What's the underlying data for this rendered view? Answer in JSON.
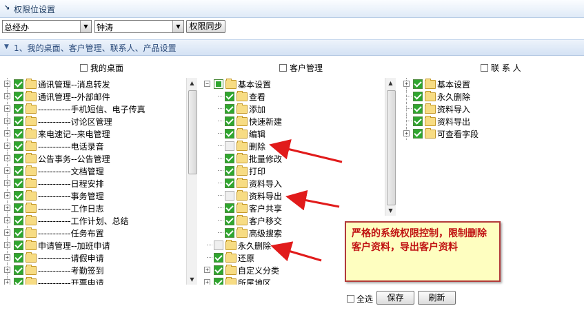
{
  "titlebar": {
    "title": "权限位设置"
  },
  "filters": {
    "department": "总经办",
    "user": "钟涛",
    "sync_button": "权限同步"
  },
  "section": {
    "title": "1、我的桌面、客户管理、联系人、产品设置"
  },
  "columns": {
    "desktop": {
      "header": "我的桌面",
      "items": [
        {
          "label": "通讯管理--消息转发",
          "state": "checked",
          "expand": "plus"
        },
        {
          "label": "通讯管理--外部邮件",
          "state": "checked",
          "expand": "plus"
        },
        {
          "label": "-----------手机短信、电子传真",
          "state": "checked",
          "expand": "plus"
        },
        {
          "label": "-----------讨论区管理",
          "state": "checked",
          "expand": "plus"
        },
        {
          "label": "来电速记--来电管理",
          "state": "checked",
          "expand": "plus"
        },
        {
          "label": "-----------电话录音",
          "state": "checked",
          "expand": "plus"
        },
        {
          "label": "公告事务--公告管理",
          "state": "checked",
          "expand": "plus"
        },
        {
          "label": "-----------文档管理",
          "state": "checked",
          "expand": "plus"
        },
        {
          "label": "-----------日程安排",
          "state": "checked",
          "expand": "plus"
        },
        {
          "label": "-----------事务管理",
          "state": "checked",
          "expand": "plus"
        },
        {
          "label": "-----------工作日志",
          "state": "checked",
          "expand": "plus"
        },
        {
          "label": "-----------工作计划、总结",
          "state": "checked",
          "expand": "plus"
        },
        {
          "label": "-----------任务布置",
          "state": "checked",
          "expand": "plus"
        },
        {
          "label": "申请管理--加班申请",
          "state": "checked",
          "expand": "plus"
        },
        {
          "label": "-----------请假申请",
          "state": "checked",
          "expand": "plus"
        },
        {
          "label": "-----------考勤签到",
          "state": "checked",
          "expand": "plus"
        },
        {
          "label": "-----------开票申请",
          "state": "checked",
          "expand": "plus"
        }
      ]
    },
    "customer": {
      "header": "客户管理",
      "items": [
        {
          "label": "基本设置",
          "state": "partial",
          "expand": "minus",
          "level": 0
        },
        {
          "label": "查看",
          "state": "checked",
          "level": 1
        },
        {
          "label": "添加",
          "state": "checked",
          "level": 1
        },
        {
          "label": "快速新建",
          "state": "checked",
          "level": 1
        },
        {
          "label": "编辑",
          "state": "checked",
          "level": 1
        },
        {
          "label": "删除",
          "state": "unchecked",
          "level": 1
        },
        {
          "label": "批量修改",
          "state": "checked",
          "level": 1
        },
        {
          "label": "打印",
          "state": "checked",
          "level": 1
        },
        {
          "label": "资料导入",
          "state": "checked",
          "level": 1
        },
        {
          "label": "资料导出",
          "state": "unchecked",
          "level": 1
        },
        {
          "label": "客户共享",
          "state": "checked",
          "level": 1
        },
        {
          "label": "客户移交",
          "state": "checked",
          "level": 1
        },
        {
          "label": "高级搜索",
          "state": "checked",
          "level": 1
        },
        {
          "label": "永久删除",
          "state": "unchecked",
          "level": 0
        },
        {
          "label": "还原",
          "state": "checked",
          "level": 0
        },
        {
          "label": "自定义分类",
          "state": "checked",
          "expand": "plus",
          "level": 0
        },
        {
          "label": "所属地区",
          "state": "checked",
          "expand": "plus",
          "level": 0
        }
      ]
    },
    "contacts": {
      "header": "联 系 人",
      "items": [
        {
          "label": "基本设置",
          "state": "checked",
          "expand": "plus"
        },
        {
          "label": "永久删除",
          "state": "checked"
        },
        {
          "label": "资料导入",
          "state": "checked"
        },
        {
          "label": "资料导出",
          "state": "checked"
        },
        {
          "label": "可查看字段",
          "state": "checked",
          "expand": "plus"
        }
      ]
    }
  },
  "callout": {
    "text": "严格的系统权限控制，限制删除客户资料，导出客户资料"
  },
  "footer": {
    "select_all": "全选",
    "save": "保存",
    "refresh": "刷新"
  },
  "colors": {
    "check_green": "#2fa62f",
    "callout_bg": "#fefec0",
    "callout_text": "#c01313",
    "arrow": "#e11b1b"
  }
}
